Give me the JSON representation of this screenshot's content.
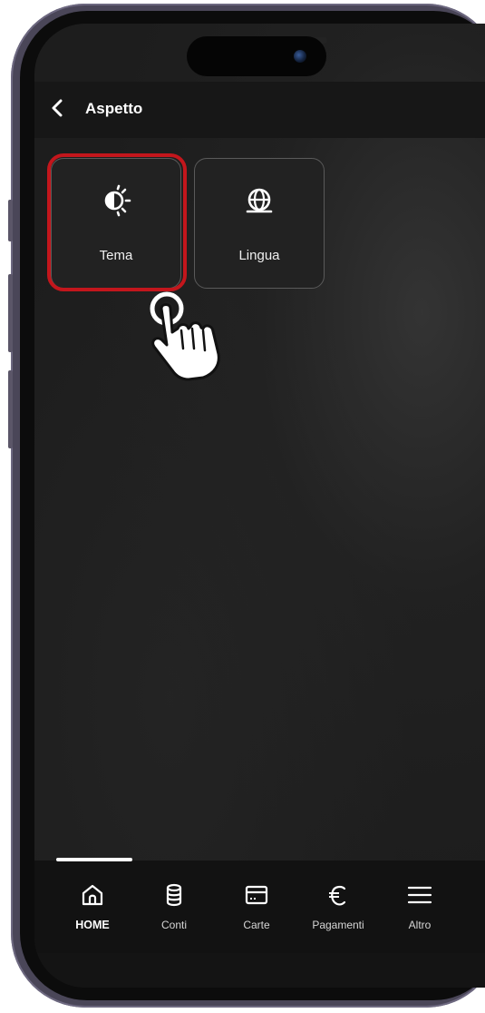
{
  "header": {
    "title": "Aspetto"
  },
  "tiles": [
    {
      "label": "Tema",
      "icon": "theme-brightness-icon",
      "highlighted": true
    },
    {
      "label": "Lingua",
      "icon": "globe-icon",
      "highlighted": false
    }
  ],
  "bottom_nav": {
    "items": [
      {
        "label": "HOME",
        "icon": "home-icon",
        "active": true
      },
      {
        "label": "Conti",
        "icon": "database-icon",
        "active": false
      },
      {
        "label": "Carte",
        "icon": "card-icon",
        "active": false
      },
      {
        "label": "Pagamenti",
        "icon": "euro-icon",
        "active": false
      },
      {
        "label": "Altro",
        "icon": "menu-icon",
        "active": false
      }
    ]
  },
  "colors": {
    "highlight": "#c3161c",
    "background": "#1d1d1d",
    "text": "#ffffff"
  }
}
